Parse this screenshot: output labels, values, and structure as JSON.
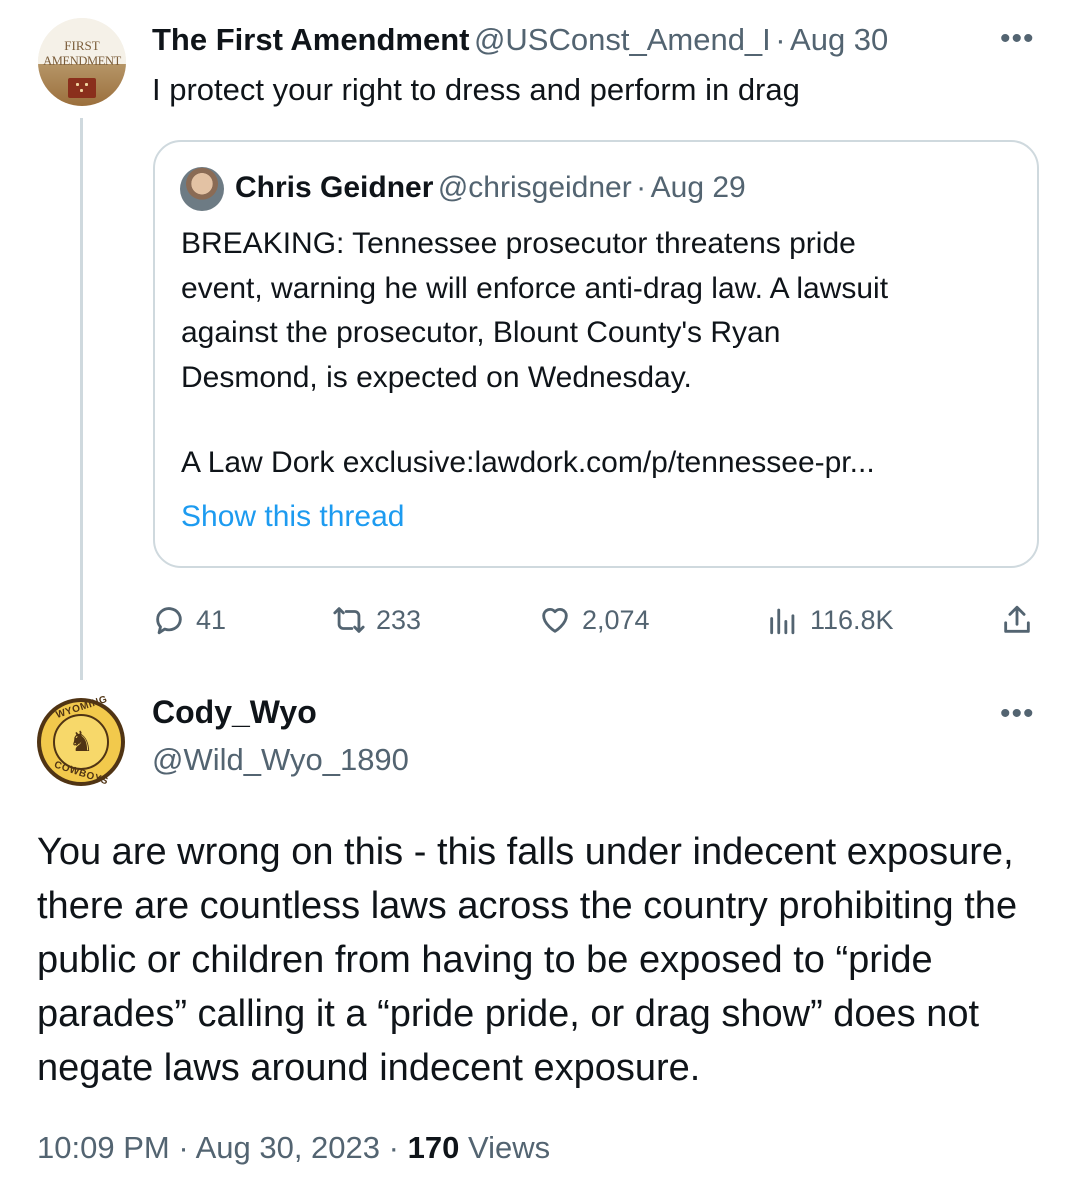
{
  "tweet1": {
    "avatar_text_line1": "FIRST",
    "avatar_text_line2": "AMENDMENT",
    "name": "The First Amendment",
    "handle": "@USConst_Amend_I",
    "sep": "·",
    "date": "Aug 30",
    "more": "•••",
    "text": "I protect your right to dress and perform in drag",
    "quote": {
      "name": "Chris Geidner",
      "handle": "@chrisgeidner",
      "sep": "·",
      "date": "Aug 29",
      "text_lines": [
        "BREAKING: Tennessee prosecutor threatens pride",
        "event, warning he will enforce anti-drag law. A lawsuit",
        "against the prosecutor, Blount County's Ryan",
        "Desmond, is expected on Wednesday."
      ],
      "link_prefix": "A Law Dork exclusive:",
      "link": "lawdork.com/p/tennessee-pr...",
      "show_thread": "Show this thread"
    },
    "actions": {
      "replies": "41",
      "retweets": "233",
      "likes": "2,074",
      "views": "116.8K"
    }
  },
  "tweet2": {
    "avatar_top": "WYOMING",
    "avatar_bottom": "COWBOYS",
    "name": "Cody_Wyo",
    "handle": "@Wild_Wyo_1890",
    "more": "•••",
    "text": "You are wrong on this - this falls under indecent exposure, there are countless laws across the country prohibiting the public or children from having to be exposed to “pride parades” calling it a “pride pride, or drag show” does not negate laws around indecent exposure.",
    "time": "10:09 PM",
    "sep1": "·",
    "date": "Aug 30, 2023",
    "sep2": "·",
    "views_count": "170",
    "views_label": "Views"
  },
  "colors": {
    "text": "#0f1419",
    "secondary": "#536471",
    "link": "#1d9bf0",
    "border": "#cfd9de"
  }
}
